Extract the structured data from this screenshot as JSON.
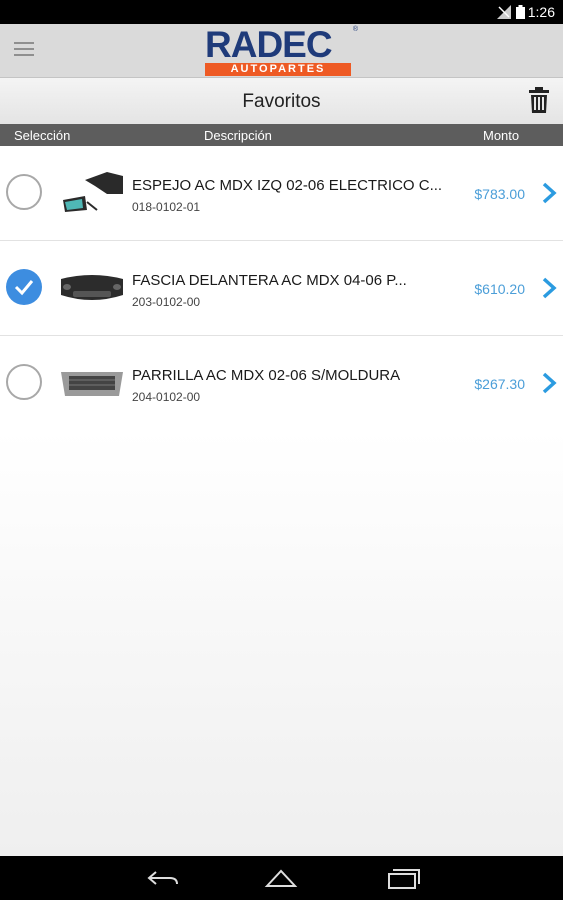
{
  "status": {
    "time": "1:26"
  },
  "header": {
    "brand": "RADEC",
    "brand_mark": "®",
    "brand_sub": "AUTOPARTES"
  },
  "page": {
    "title": "Favoritos"
  },
  "columns": {
    "selection": "Selección",
    "description": "Descripción",
    "amount": "Monto"
  },
  "items": [
    {
      "description": "ESPEJO AC MDX IZQ 02-06 ELECTRICO C...",
      "code": "018-0102-01",
      "price": "$783.00",
      "selected": false
    },
    {
      "description": "FASCIA DELANTERA AC MDX 04-06 P...",
      "code": "203-0102-00",
      "price": "$610.20",
      "selected": true
    },
    {
      "description": "PARRILLA AC MDX 02-06 S/MOLDURA",
      "code": "204-0102-00",
      "price": "$267.30",
      "selected": false
    }
  ],
  "colors": {
    "accent": "#3d8de0",
    "price": "#4b9ed8",
    "brand_blue": "#1f3b7a",
    "brand_orange": "#ee5a24"
  }
}
